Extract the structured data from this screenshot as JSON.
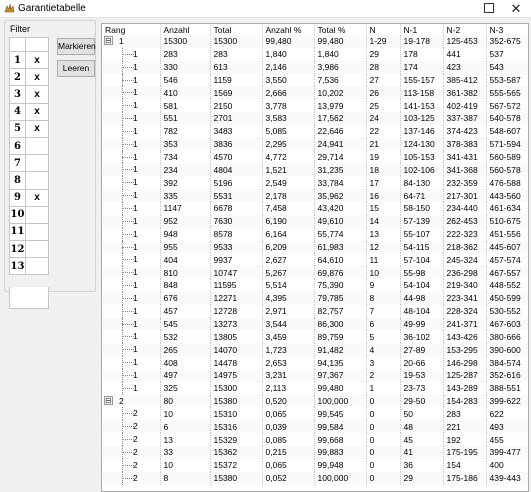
{
  "window": {
    "title": "Garantietabelle",
    "close_glyph": "✕"
  },
  "filter": {
    "label": "Filter",
    "rows": [
      {
        "n": "1",
        "mark": "x"
      },
      {
        "n": "2",
        "mark": "x"
      },
      {
        "n": "3",
        "mark": "x"
      },
      {
        "n": "4",
        "mark": "x"
      },
      {
        "n": "5",
        "mark": "x"
      },
      {
        "n": "6",
        "mark": ""
      },
      {
        "n": "7",
        "mark": ""
      },
      {
        "n": "8",
        "mark": ""
      },
      {
        "n": "9",
        "mark": "x"
      },
      {
        "n": "10",
        "mark": ""
      },
      {
        "n": "11",
        "mark": ""
      },
      {
        "n": "12",
        "mark": ""
      },
      {
        "n": "13",
        "mark": ""
      }
    ],
    "markieren_label": "Markieren",
    "leeren_label": "Leeren"
  },
  "grid": {
    "columns": [
      "Rang",
      "Anzahl",
      "Total",
      "Anzahl %",
      "Total %",
      "N",
      "N-1",
      "N-2",
      "N-3"
    ],
    "rows": [
      {
        "level": 0,
        "toggle": "⊟",
        "rang": "1",
        "cells": [
          "15300",
          "15300",
          "99,480",
          "99,480",
          "1-29",
          "19-178",
          "125-453",
          "352-675"
        ]
      },
      {
        "level": 1,
        "rang": "1",
        "cells": [
          "283",
          "283",
          "1,840",
          "1,840",
          "29",
          "178",
          "441",
          "537"
        ]
      },
      {
        "level": 1,
        "rang": "1",
        "cells": [
          "330",
          "613",
          "2,146",
          "3,986",
          "28",
          "174",
          "423",
          "543"
        ]
      },
      {
        "level": 1,
        "rang": "1",
        "cells": [
          "546",
          "1159",
          "3,550",
          "7,536",
          "27",
          "155-157",
          "385-412",
          "553-587"
        ]
      },
      {
        "level": 1,
        "rang": "1",
        "cells": [
          "410",
          "1569",
          "2,666",
          "10,202",
          "26",
          "113-158",
          "361-382",
          "555-565"
        ]
      },
      {
        "level": 1,
        "rang": "1",
        "cells": [
          "581",
          "2150",
          "3,778",
          "13,979",
          "25",
          "141-153",
          "402-419",
          "567-572"
        ]
      },
      {
        "level": 1,
        "rang": "1",
        "cells": [
          "551",
          "2701",
          "3,583",
          "17,562",
          "24",
          "103-125",
          "337-387",
          "540-578"
        ]
      },
      {
        "level": 1,
        "rang": "1",
        "cells": [
          "782",
          "3483",
          "5,085",
          "22,646",
          "22",
          "137-146",
          "374-423",
          "548-607"
        ]
      },
      {
        "level": 1,
        "rang": "1",
        "cells": [
          "353",
          "3836",
          "2,295",
          "24,941",
          "21",
          "124-130",
          "378-383",
          "571-594"
        ]
      },
      {
        "level": 1,
        "rang": "1",
        "cells": [
          "734",
          "4570",
          "4,772",
          "29,714",
          "19",
          "105-153",
          "341-431",
          "560-589"
        ]
      },
      {
        "level": 1,
        "rang": "1",
        "cells": [
          "234",
          "4804",
          "1,521",
          "31,235",
          "18",
          "102-106",
          "341-368",
          "560-578"
        ]
      },
      {
        "level": 1,
        "rang": "1",
        "cells": [
          "392",
          "5196",
          "2,549",
          "33,784",
          "17",
          "84-130",
          "232-359",
          "476-588"
        ]
      },
      {
        "level": 1,
        "rang": "1",
        "cells": [
          "335",
          "5531",
          "2,178",
          "35,962",
          "16",
          "64-71",
          "217-301",
          "443-560"
        ]
      },
      {
        "level": 1,
        "rang": "1",
        "cells": [
          "1147",
          "6678",
          "7,458",
          "43,420",
          "15",
          "58-150",
          "234-440",
          "461-634"
        ]
      },
      {
        "level": 1,
        "rang": "1",
        "cells": [
          "952",
          "7630",
          "6,190",
          "49,610",
          "14",
          "57-139",
          "262-453",
          "510-675"
        ]
      },
      {
        "level": 1,
        "rang": "1",
        "cells": [
          "948",
          "8578",
          "6,164",
          "55,774",
          "13",
          "55-107",
          "222-323",
          "451-556"
        ]
      },
      {
        "level": 1,
        "rang": "1",
        "cells": [
          "955",
          "9533",
          "6,209",
          "61,983",
          "12",
          "54-115",
          "218-362",
          "445-607"
        ]
      },
      {
        "level": 1,
        "rang": "1",
        "cells": [
          "404",
          "9937",
          "2,627",
          "64,610",
          "11",
          "57-104",
          "245-324",
          "457-574"
        ]
      },
      {
        "level": 1,
        "rang": "1",
        "cells": [
          "810",
          "10747",
          "5,267",
          "69,876",
          "10",
          "55-98",
          "236-298",
          "467-557"
        ]
      },
      {
        "level": 1,
        "rang": "1",
        "cells": [
          "848",
          "11595",
          "5,514",
          "75,390",
          "9",
          "54-104",
          "219-340",
          "448-552"
        ]
      },
      {
        "level": 1,
        "rang": "1",
        "cells": [
          "676",
          "12271",
          "4,395",
          "79,785",
          "8",
          "44-98",
          "223-341",
          "450-599"
        ]
      },
      {
        "level": 1,
        "rang": "1",
        "cells": [
          "457",
          "12728",
          "2,971",
          "82,757",
          "7",
          "48-104",
          "228-324",
          "530-552"
        ]
      },
      {
        "level": 1,
        "rang": "1",
        "cells": [
          "545",
          "13273",
          "3,544",
          "86,300",
          "6",
          "49-99",
          "241-371",
          "467-603"
        ]
      },
      {
        "level": 1,
        "rang": "1",
        "cells": [
          "532",
          "13805",
          "3,459",
          "89,759",
          "5",
          "36-102",
          "143-426",
          "380-666"
        ]
      },
      {
        "level": 1,
        "rang": "1",
        "cells": [
          "265",
          "14070",
          "1,723",
          "91,482",
          "4",
          "27-89",
          "153-295",
          "390-600"
        ]
      },
      {
        "level": 1,
        "rang": "1",
        "cells": [
          "408",
          "14478",
          "2,653",
          "94,135",
          "3",
          "20-66",
          "146-298",
          "384-574"
        ]
      },
      {
        "level": 1,
        "rang": "1",
        "cells": [
          "497",
          "14975",
          "3,231",
          "97,367",
          "2",
          "19-53",
          "125-287",
          "352-616"
        ]
      },
      {
        "level": 1,
        "rang": "1",
        "cells": [
          "325",
          "15300",
          "2,113",
          "99,480",
          "1",
          "23-73",
          "143-289",
          "388-551"
        ]
      },
      {
        "level": 0,
        "toggle": "⊟",
        "rang": "2",
        "cells": [
          "80",
          "15380",
          "0,520",
          "100,000",
          "0",
          "29-50",
          "154-283",
          "399-622"
        ]
      },
      {
        "level": 1,
        "rang": "2",
        "cells": [
          "10",
          "15310",
          "0,065",
          "99,545",
          "0",
          "50",
          "283",
          "622"
        ]
      },
      {
        "level": 1,
        "rang": "2",
        "cells": [
          "6",
          "15316",
          "0,039",
          "99,584",
          "0",
          "48",
          "221",
          "493"
        ]
      },
      {
        "level": 1,
        "rang": "2",
        "cells": [
          "13",
          "15329",
          "0,085",
          "99,668",
          "0",
          "45",
          "192",
          "455"
        ]
      },
      {
        "level": 1,
        "rang": "2",
        "cells": [
          "33",
          "15362",
          "0,215",
          "99,883",
          "0",
          "41",
          "175-195",
          "399-477"
        ]
      },
      {
        "level": 1,
        "rang": "2",
        "cells": [
          "10",
          "15372",
          "0,065",
          "99,948",
          "0",
          "36",
          "154",
          "400"
        ]
      },
      {
        "level": 1,
        "rang": "2",
        "cells": [
          "8",
          "15380",
          "0,052",
          "100,000",
          "0",
          "29",
          "175-186",
          "439-443"
        ]
      }
    ]
  }
}
